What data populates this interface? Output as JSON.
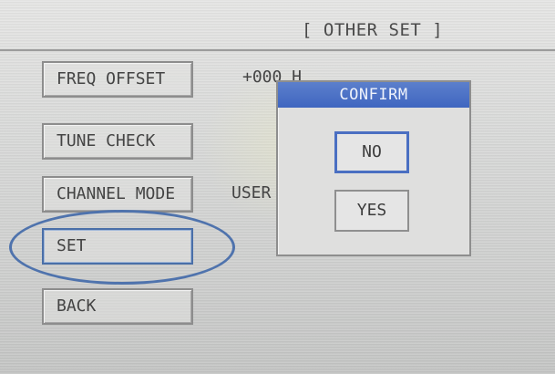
{
  "header": {
    "title": "[ OTHER SET ]"
  },
  "menu": {
    "items": [
      {
        "label": "FREQ OFFSET",
        "value": "+000 H"
      },
      {
        "label": "TUNE CHECK",
        "value": ""
      },
      {
        "label": "CHANNEL MODE",
        "value": "USER"
      },
      {
        "label": "SET",
        "value": ""
      },
      {
        "label": "BACK",
        "value": ""
      }
    ]
  },
  "dialog": {
    "title": "CONFIRM",
    "no_label": "NO",
    "yes_label": "YES"
  },
  "colors": {
    "dialog_title_bg": "#4468c2",
    "focus_border": "#4a6fc2",
    "highlight_ring": "#4f73ad"
  },
  "icons": []
}
